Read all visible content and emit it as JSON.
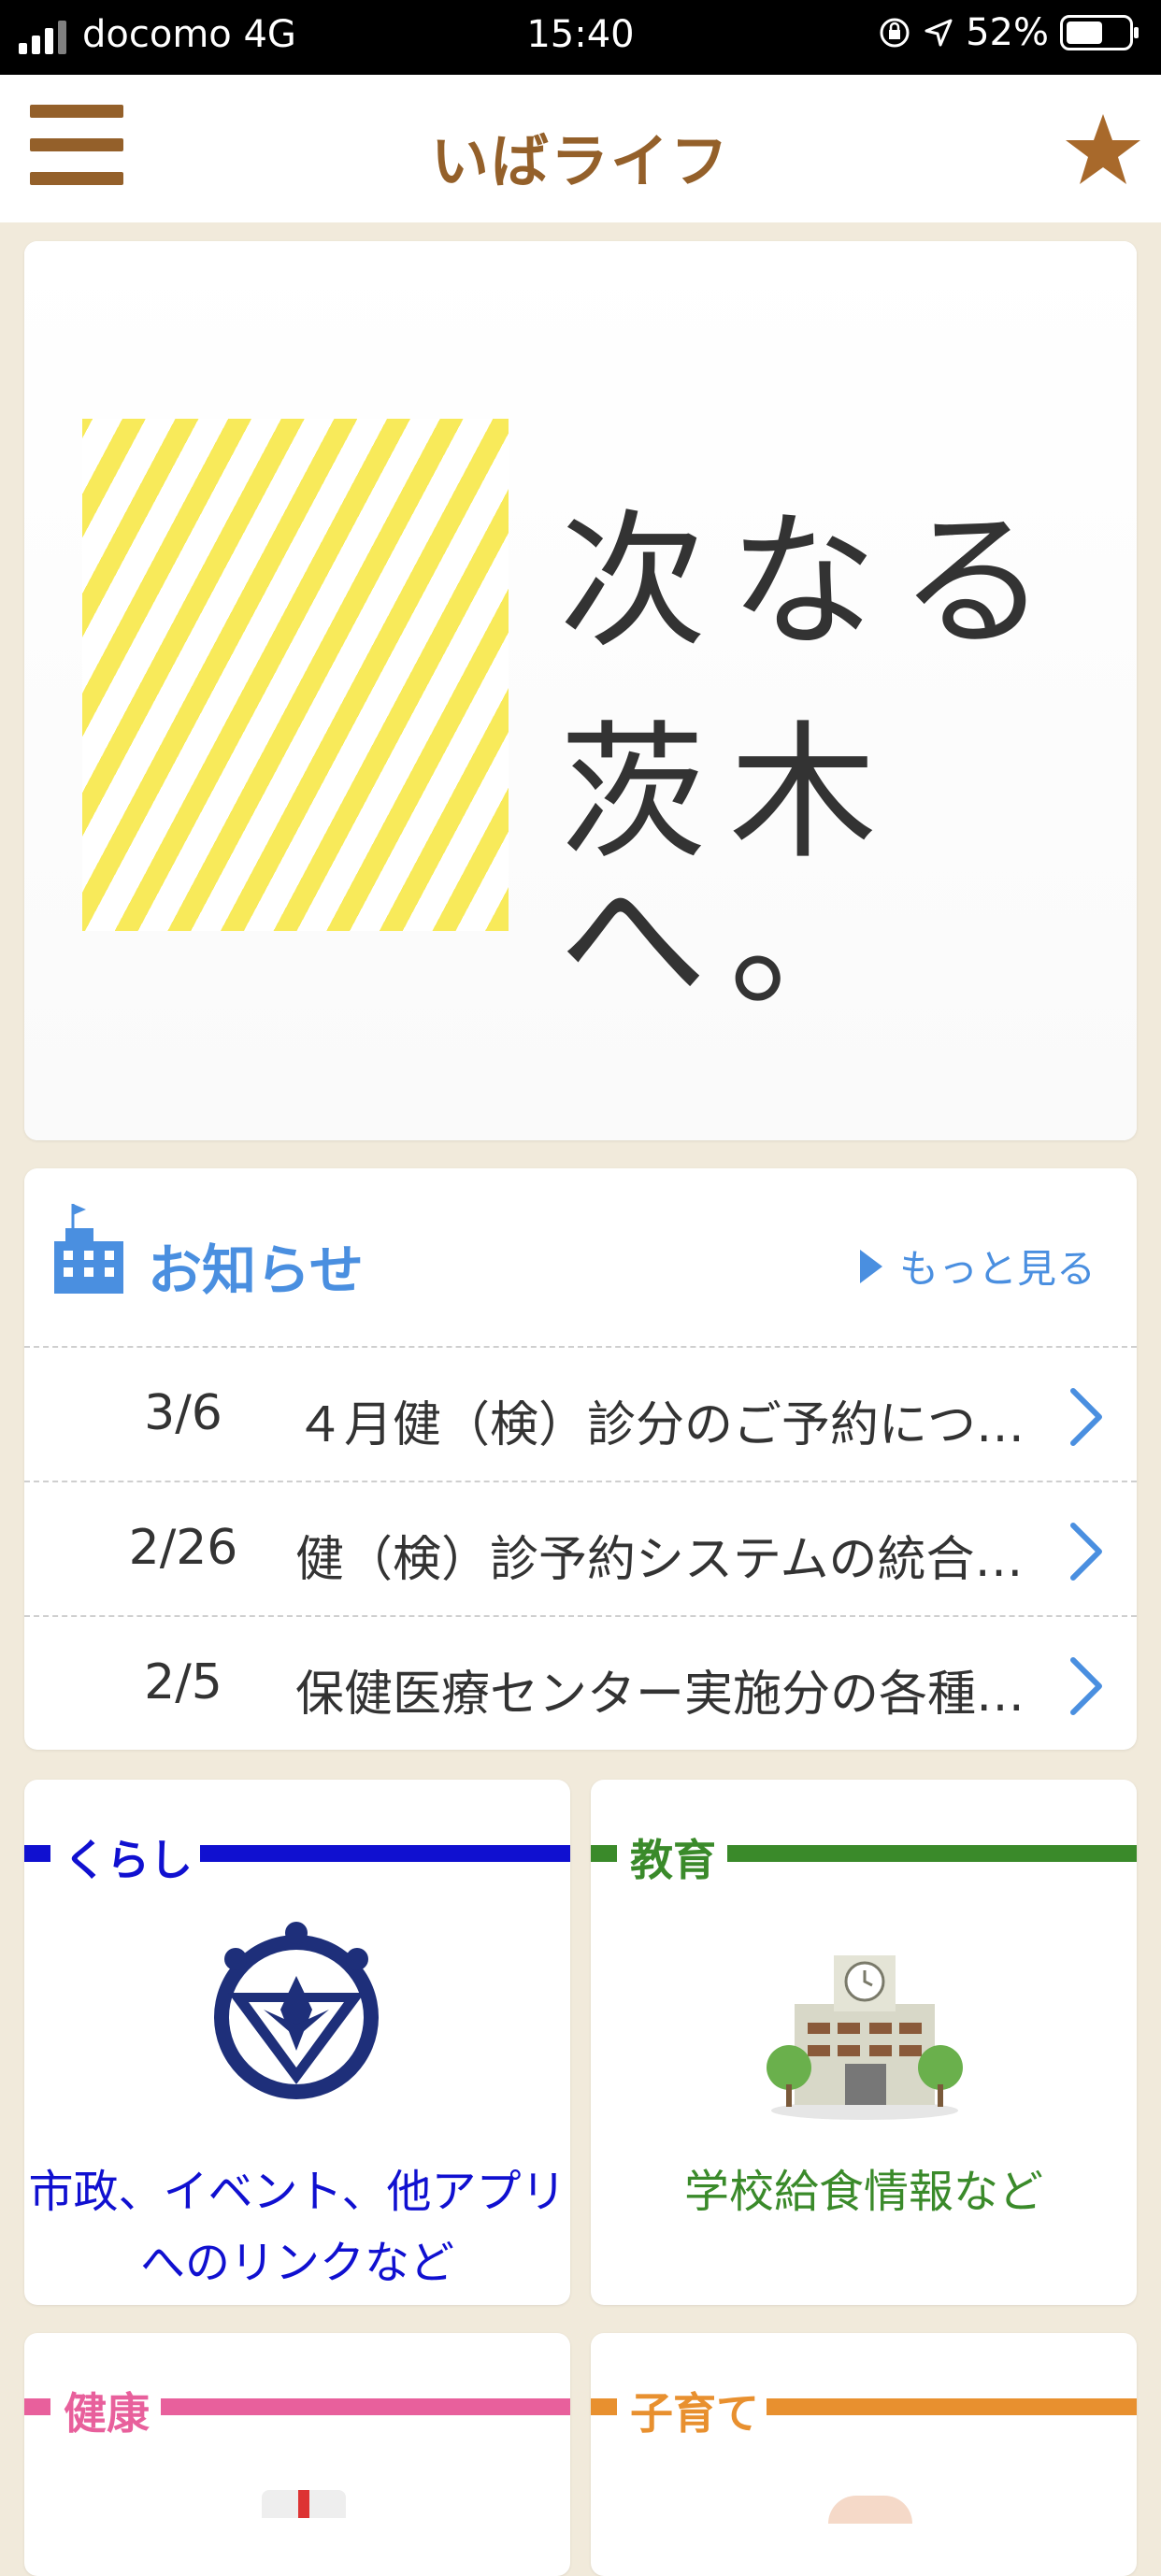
{
  "status_bar": {
    "carrier": "docomo 4G",
    "time": "15:40",
    "battery": "52%"
  },
  "header": {
    "title": "いばライフ"
  },
  "banner": {
    "line1": "次なる",
    "line2": "茨木へ。"
  },
  "news": {
    "title": "お知らせ",
    "more_label": "もっと見る",
    "items": [
      {
        "date": "3/6",
        "text": "４月健（検）診分のご予約につ…"
      },
      {
        "date": "2/26",
        "text": "健（検）診予約システムの統合…"
      },
      {
        "date": "2/5",
        "text": "保健医療センター実施分の各種…"
      }
    ]
  },
  "categories": [
    {
      "label": "くらし",
      "caption_line1": "市政、イベント、他アプリ",
      "caption_line2": "へのリンクなど"
    },
    {
      "label": "教育",
      "caption_line1": "学校給食情報など",
      "caption_line2": ""
    },
    {
      "label": "健康",
      "caption_line1": "",
      "caption_line2": ""
    },
    {
      "label": "子育て",
      "caption_line1": "",
      "caption_line2": ""
    }
  ],
  "colors": {
    "brand_brown": "#94602a",
    "star": "#a8692b",
    "news_blue": "#4a8fe0",
    "kurashi_blue": "#1010d0",
    "kyouiku_green": "#3a8a2a",
    "kenkou_pink": "#e8609c",
    "kosodate_orange": "#e8902f"
  }
}
